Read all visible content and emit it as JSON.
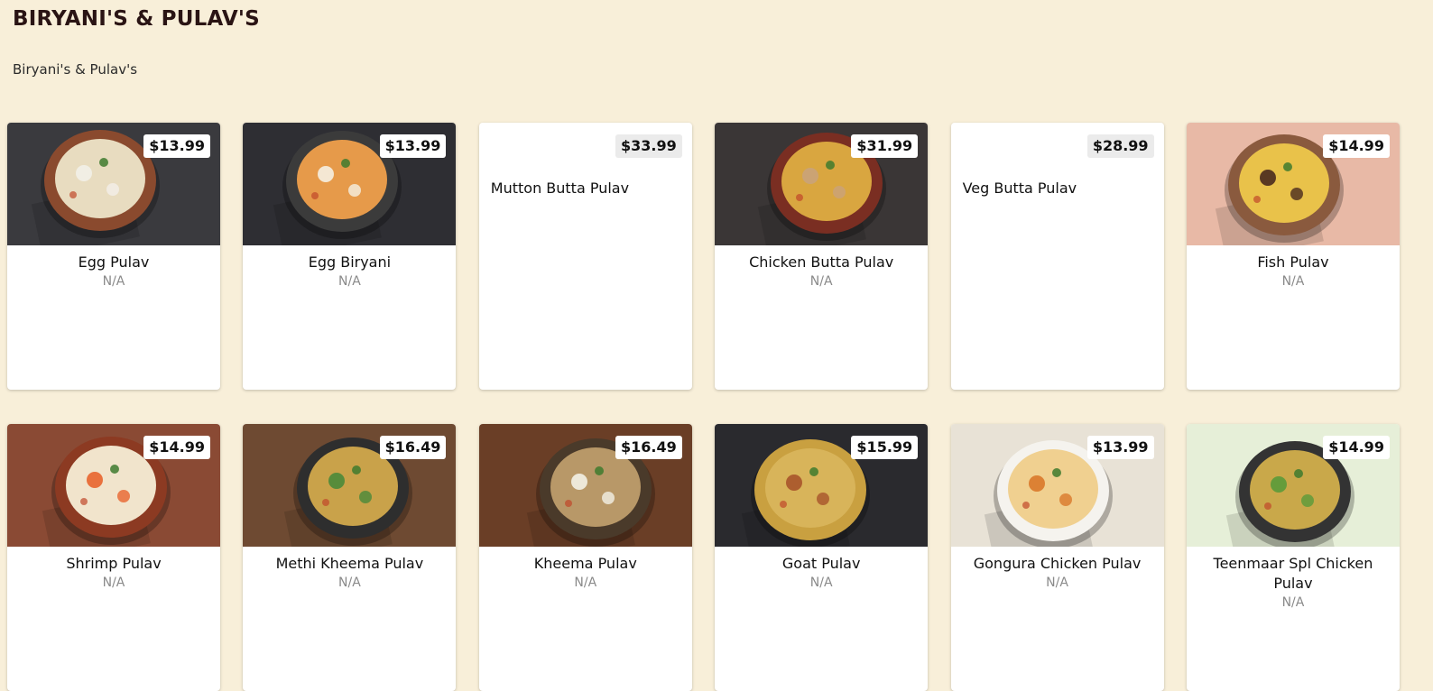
{
  "category": {
    "title": "BIRYANI'S & PULAV'S",
    "subtitle": "Biryani's & Pulav's"
  },
  "items": [
    {
      "name": "Egg Pulav",
      "price": "$13.99",
      "desc": "N/A",
      "has_image": true,
      "image_icon": "egg-pulav-photo",
      "bg": "#3a3a3e",
      "plate": "#8a4a2e",
      "food": "#e8dcc0",
      "accent": "#f2efe8"
    },
    {
      "name": "Egg Biryani",
      "price": "$13.99",
      "desc": "N/A",
      "has_image": true,
      "image_icon": "egg-biryani-photo",
      "bg": "#2e2e33",
      "plate": "#3b3b3b",
      "food": "#e69a4a",
      "accent": "#f5f0e2"
    },
    {
      "name": "Mutton Butta Pulav",
      "price": "$33.99",
      "desc": "",
      "has_image": false
    },
    {
      "name": "Chicken Butta Pulav",
      "price": "$31.99",
      "desc": "N/A",
      "has_image": true,
      "image_icon": "chicken-butta-pulav-photo",
      "bg": "#3a3636",
      "plate": "#7a2e22",
      "food": "#d9a640",
      "accent": "#c9a37a"
    },
    {
      "name": "Veg Butta Pulav",
      "price": "$28.99",
      "desc": "",
      "has_image": false
    },
    {
      "name": "Fish Pulav",
      "price": "$14.99",
      "desc": "N/A",
      "has_image": true,
      "image_icon": "fish-pulav-photo",
      "bg": "#e8b9a6",
      "plate": "#8a5a3e",
      "food": "#e9c24a",
      "accent": "#4a2a1e"
    },
    {
      "name": "Shrimp Pulav",
      "price": "$14.99",
      "desc": "N/A",
      "has_image": true,
      "image_icon": "shrimp-pulav-photo",
      "bg": "#8a4a34",
      "plate": "#8c3a22",
      "food": "#f1e4cc",
      "accent": "#e8642e"
    },
    {
      "name": "Methi Kheema Pulav",
      "price": "$16.49",
      "desc": "N/A",
      "has_image": true,
      "image_icon": "methi-kheema-pulav-photo",
      "bg": "#6e4a32",
      "plate": "#2e2e2e",
      "food": "#c9a24a",
      "accent": "#4a8a3a"
    },
    {
      "name": "Kheema Pulav",
      "price": "$16.49",
      "desc": "N/A",
      "has_image": true,
      "image_icon": "kheema-pulav-photo",
      "bg": "#6a3e26",
      "plate": "#4a3a2a",
      "food": "#b89868",
      "accent": "#f3f1e6"
    },
    {
      "name": "Goat Pulav",
      "price": "$15.99",
      "desc": "N/A",
      "has_image": true,
      "image_icon": "goat-pulav-photo",
      "bg": "#2a2a2e",
      "plate": "#c9a040",
      "food": "#d8b45a",
      "accent": "#a8542a"
    },
    {
      "name": "Gongura Chicken Pulav",
      "price": "$13.99",
      "desc": "N/A",
      "has_image": true,
      "image_icon": "gongura-chicken-pulav-photo",
      "bg": "#e8e2d6",
      "plate": "#f5f3ee",
      "food": "#f0d090",
      "accent": "#d9782a"
    },
    {
      "name": "Teenmaar Spl Chicken Pulav",
      "price": "$14.99",
      "desc": "N/A",
      "has_image": true,
      "image_icon": "teenmaar-spl-chicken-pulav-photo",
      "bg": "#e6efd8",
      "plate": "#333333",
      "food": "#c9a84a",
      "accent": "#5a9a3a"
    }
  ]
}
